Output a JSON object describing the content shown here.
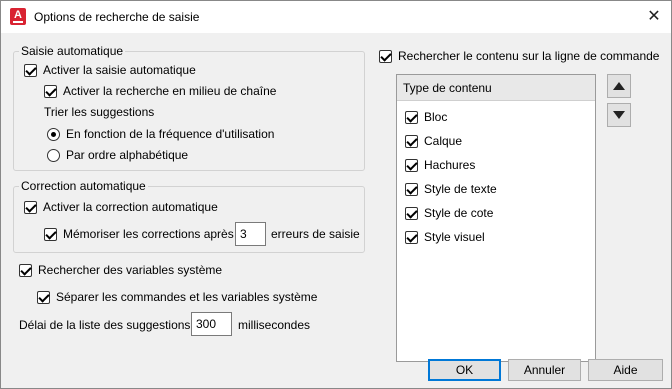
{
  "window": {
    "title": "Options de recherche de saisie",
    "close": "✕",
    "app_icon": "A"
  },
  "autocomplete": {
    "group_label": "Saisie automatique",
    "enable": "Activer la saisie automatique",
    "midstring": "Activer la recherche en milieu de chaîne",
    "sort_label": "Trier les suggestions",
    "sort_frequency": "En fonction de la fréquence d'utilisation",
    "sort_alpha": "Par ordre alphabétique"
  },
  "autocorrect": {
    "group_label": "Correction automatique",
    "enable": "Activer la correction automatique",
    "remember_prefix": "Mémoriser les corrections après",
    "remember_value": "3",
    "remember_suffix": "erreurs de saisie"
  },
  "sysvars": {
    "search": "Rechercher des variables système",
    "separate": "Séparer les commandes et les variables système"
  },
  "delay": {
    "label": "Délai de la liste des suggestions",
    "value": "300",
    "unit": "millisecondes"
  },
  "content_search": {
    "label": "Rechercher le contenu sur la ligne de commande",
    "column_header": "Type de contenu",
    "items": [
      "Bloc",
      "Calque",
      "Hachures",
      "Style de texte",
      "Style de cote",
      "Style visuel"
    ]
  },
  "buttons": {
    "ok": "OK",
    "cancel": "Annuler",
    "help": "Aide"
  }
}
